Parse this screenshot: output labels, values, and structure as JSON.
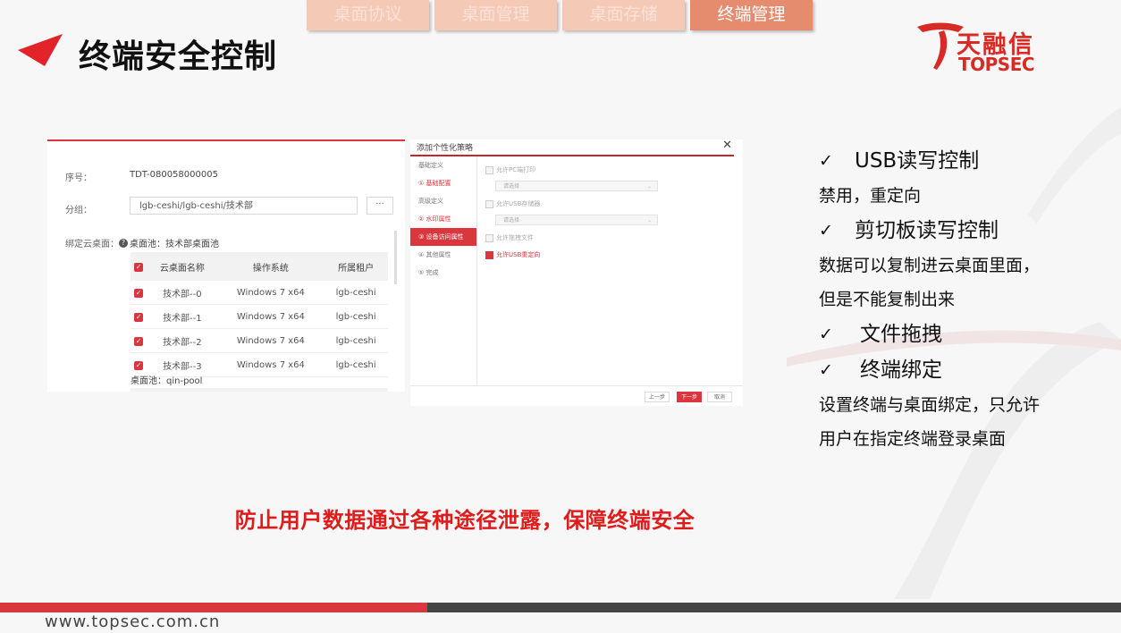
{
  "top_tabs": [
    {
      "label": "桌面协议",
      "active": false
    },
    {
      "label": "桌面管理",
      "active": false
    },
    {
      "label": "桌面存储",
      "active": false
    },
    {
      "label": "终端管理",
      "active": true
    }
  ],
  "page_title": "终端安全控制",
  "logo": {
    "cn": "天融信",
    "en": "TOPSEC"
  },
  "form": {
    "serial_label": "序号：",
    "serial_value": "TDT-080058000005",
    "group_label": "分组：",
    "group_value": "lgb-ceshi/lgb-ceshi/技术部",
    "group_button": "···",
    "bind_label": "绑定云桌面：",
    "pool_label": "桌面池：技术部桌面池",
    "table_headers": [
      "云桌面名称",
      "操作系统",
      "所属租户"
    ],
    "rows": [
      {
        "name": "技术部--0",
        "os": "Windows 7 x64",
        "tenant": "lgb-ceshi"
      },
      {
        "name": "技术部--1",
        "os": "Windows 7 x64",
        "tenant": "lgb-ceshi"
      },
      {
        "name": "技术部--2",
        "os": "Windows 7 x64",
        "tenant": "lgb-ceshi"
      },
      {
        "name": "技术部--3",
        "os": "Windows 7 x64",
        "tenant": "lgb-ceshi"
      }
    ],
    "pool2_label": "桌面池：qin-pool"
  },
  "dialog": {
    "title": "添加个性化策略",
    "nav": [
      "基础定义",
      "① 基础配置",
      "高级定义",
      "② 水印属性",
      "③ 设备访问属性",
      "④ 其他属性",
      "⑤ 完成"
    ],
    "options": {
      "pc_print": "允许PC端打印",
      "select1": "请选择",
      "usb_storage": "允许USB存储器",
      "select2": "请选择",
      "file_drag": "允许拖拽文件",
      "usb_redirect": "允许USB重定向"
    },
    "buttons": {
      "prev": "上一步",
      "next": "下一步",
      "cancel": "取消"
    }
  },
  "features": [
    {
      "title": "USB读写控制",
      "desc": [
        "禁用，重定向"
      ]
    },
    {
      "title": "剪切板读写控制",
      "desc": [
        "数据可以复制进云桌面里面，",
        "但是不能复制出来"
      ]
    },
    {
      "title": "文件拖拽",
      "desc": []
    },
    {
      "title": "终端绑定",
      "desc": [
        "设置终端与桌面绑定，只允许",
        "用户在指定终端登录桌面"
      ]
    }
  ],
  "check_glyph": "✓",
  "slogan": "防止用户数据通过各种途径泄露，保障终端安全",
  "footer_url": "www.topsec.com.cn",
  "colors": {
    "accent_red": "#d9363e",
    "slogan_red": "#e01b1b",
    "tab_active": "#e48c6d",
    "tab_inactive": "#f4c9b6"
  }
}
